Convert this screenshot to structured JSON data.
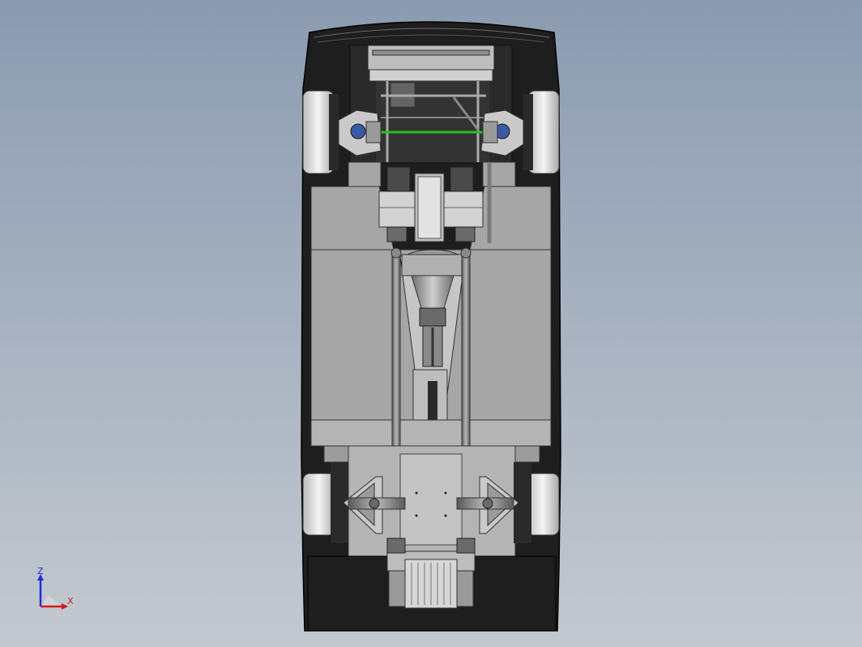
{
  "viewport": {
    "background_top": "#8b9bb0",
    "background_bottom": "#c4c9d0"
  },
  "model": {
    "description_icon": "car-chassis-bottom-view",
    "colors": {
      "body": "#1e1e1e",
      "panel": "#a6a6a6",
      "panel_dark": "#8c8c8c",
      "tire": "#e8e8e8",
      "highlight": "#22c022",
      "bearing": "#3a5aa8"
    }
  },
  "triad": {
    "z_label": "Z",
    "x_label": "X",
    "z_color": "#1b2fd6",
    "x_color": "#d21b1b"
  }
}
